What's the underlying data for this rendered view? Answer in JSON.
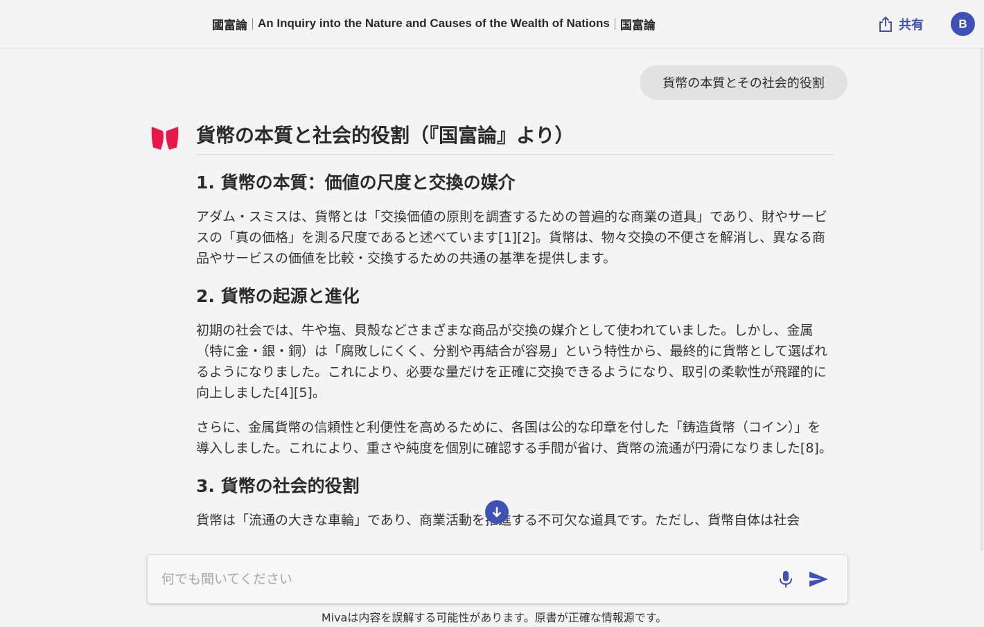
{
  "header": {
    "title_left": "國富論",
    "title_main": "An Inquiry into the Nature and Causes of the Wealth of Nations",
    "title_right": "国富論",
    "share_label": "共有",
    "share_icon": "share-icon",
    "avatar_initial": "B"
  },
  "colors": {
    "accent": "#3f51b5",
    "logo": "#e8174a",
    "background": "#f4f4f4",
    "user_bubble": "#e2e2e2"
  },
  "user_message": "貨幣の本質とその社会的役割",
  "answer": {
    "title": "貨幣の本質と社会的役割（『国富論』より）",
    "sections": [
      {
        "heading": "1. 貨幣の本質：価値の尺度と交換の媒介",
        "paragraphs": [
          "アダム・スミスは、貨幣とは「交換価値の原則を調査するための普遍的な商業の道具」であり、財やサービスの「真の価格」を測る尺度であると述べています[1][2]。貨幣は、物々交換の不便さを解消し、異なる商品やサービスの価値を比較・交換するための共通の基準を提供します。"
        ]
      },
      {
        "heading": "2. 貨幣の起源と進化",
        "paragraphs": [
          "初期の社会では、牛や塩、貝殻などさまざまな商品が交換の媒介として使われていました。しかし、金属（特に金・銀・銅）は「腐敗しにくく、分割や再結合が容易」という特性から、最終的に貨幣として選ばれるようになりました。これにより、必要な量だけを正確に交換できるようになり、取引の柔軟性が飛躍的に向上しました[4][5]。",
          "さらに、金属貨幣の信頼性と利便性を高めるために、各国は公的な印章を付した「鋳造貨幣（コイン）」を導入しました。これにより、重さや純度を個別に確認する手間が省け、貨幣の流通が円滑になりました[8]。"
        ]
      },
      {
        "heading": "3. 貨幣の社会的役割",
        "paragraphs": [
          "貨幣は「流通の大きな車輪」であり、商業活動を推進する不可欠な道具です。ただし、貨幣自体は社会"
        ]
      }
    ]
  },
  "input": {
    "placeholder": "何でも聞いてください",
    "value": ""
  },
  "disclaimer": "Mivaは内容を誤解する可能性があります。原書が正確な情報源です。"
}
